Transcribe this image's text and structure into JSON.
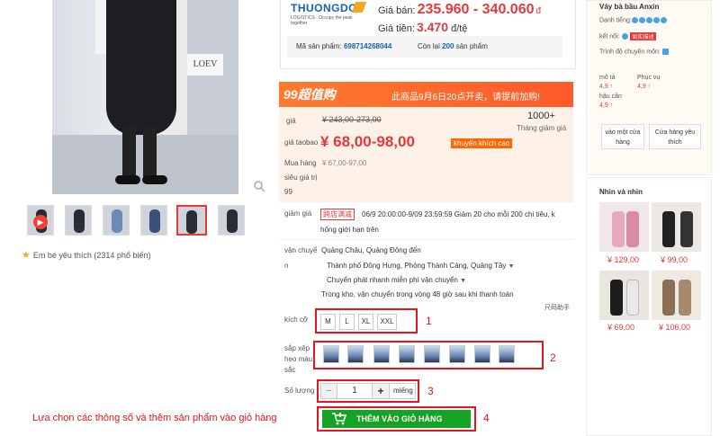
{
  "gallery": {
    "sign_text": "LOEV",
    "favorite_text": "Em bé yêu thích (2314 phổ biến)"
  },
  "logistics": {
    "logo_text": "THUONGDO",
    "logo_sub": "LOGISTICS",
    "logo_tagline": "Occupy the peak together",
    "price_vnd_label": "Giá bán:",
    "price_vnd_value": "235.960 - 340.060",
    "price_vnd_unit": "đ",
    "rate_label": "Giá tiền:",
    "rate_value": "3.470",
    "rate_unit": "đ/tệ",
    "product_code_label": "Mã sản phẩm:",
    "product_code": "698714268044",
    "stock_label_prefix": "Còn lại",
    "stock_value": "200",
    "stock_label_suffix": "sản phẩm"
  },
  "promo": {
    "badge": "99超值购",
    "text": "此商品9月6日20点开卖，请提前加购!"
  },
  "pricing": {
    "price_label": "giá",
    "original_price": "¥ 243,00-273,00",
    "taobao_label": "giá taobao",
    "taobao_price": "¥ 68,00-98,00",
    "taobao_tag": "khuyến khích cao",
    "buy_label": "Mua hàng",
    "buy_price": "¥ 67,00-97,00",
    "value_label": "siêu giá trị",
    "value_number": "99",
    "sold_count": "1000+",
    "sold_label": "Tháng giảm giá"
  },
  "sale": {
    "label": "giảm giá",
    "tag": "跨店满减",
    "line1": "06/9 20:00:00-9/09 23:59:59 Giảm 20 cho mỗi 200 chi tiêu, k",
    "line2": "hống giới hạn trên"
  },
  "shipping": {
    "label_a": "vận chuyể",
    "label_b": "n",
    "from": "Quảng Châu, Quảng Đông đến",
    "to": "Thành phố Đông Hưng, Phòng Thành Cảng, Quảng Tây",
    "method": "Chuyển phát nhanh miễn phí vận chuyển",
    "note": "Trong kho, vận chuyển trong vòng 48 giờ sau khi thanh toán",
    "size_chart": "尺码助手"
  },
  "options": {
    "size_label": "kích cỡ",
    "sizes": [
      "M",
      "L",
      "XL",
      "XXL"
    ],
    "color_label_1": "sắp xếp",
    "color_label_2": "heo màu",
    "color_label_3": "sắc",
    "quantity_label": "Số lượng",
    "quantity_minus": "−",
    "quantity_value": "1",
    "quantity_plus": "+",
    "quantity_unit": "miếng",
    "add_to_cart": "THÊM VÀO GIỎ HÀNG",
    "cart_icon": "cart-plus-icon"
  },
  "annotations": {
    "caption": "Lựa chọn các thông số và thêm sản phẩm vào giỏ hàng",
    "n1": "1",
    "n2": "2",
    "n3": "3",
    "n4": "4",
    "color": "#e4151b"
  },
  "shop": {
    "name": "Váy bà bầu Anxin",
    "title_label": "Danh tiếng:",
    "connect_label": "kết nối:",
    "tmall_tag": "如实描述",
    "expert_label": "Trình độ chuyên môn:",
    "rating_desc_label": "mô tả",
    "rating_desc_value": "4,9 ↑",
    "rating_service_label": "Phục vụ",
    "rating_service_value": "4,9 ↑",
    "rating_ship_label": "hậu cần",
    "rating_ship_value": "4,9 ↑",
    "btn_visit": "vào một cửa hàng",
    "btn_fav": "Cửa hàng yêu thích"
  },
  "related": {
    "title": "Nhìn và nhìn",
    "items": [
      {
        "price": "¥ 129,00"
      },
      {
        "price": "¥ 99,00"
      },
      {
        "price": "¥ 69,00"
      },
      {
        "price": "¥ 106,00"
      }
    ]
  },
  "colors": {
    "accent_red": "#e4393c",
    "cart_green": "#16a325",
    "promo_orange": "#ff7a2f",
    "link_blue": "#1a5fb4"
  }
}
